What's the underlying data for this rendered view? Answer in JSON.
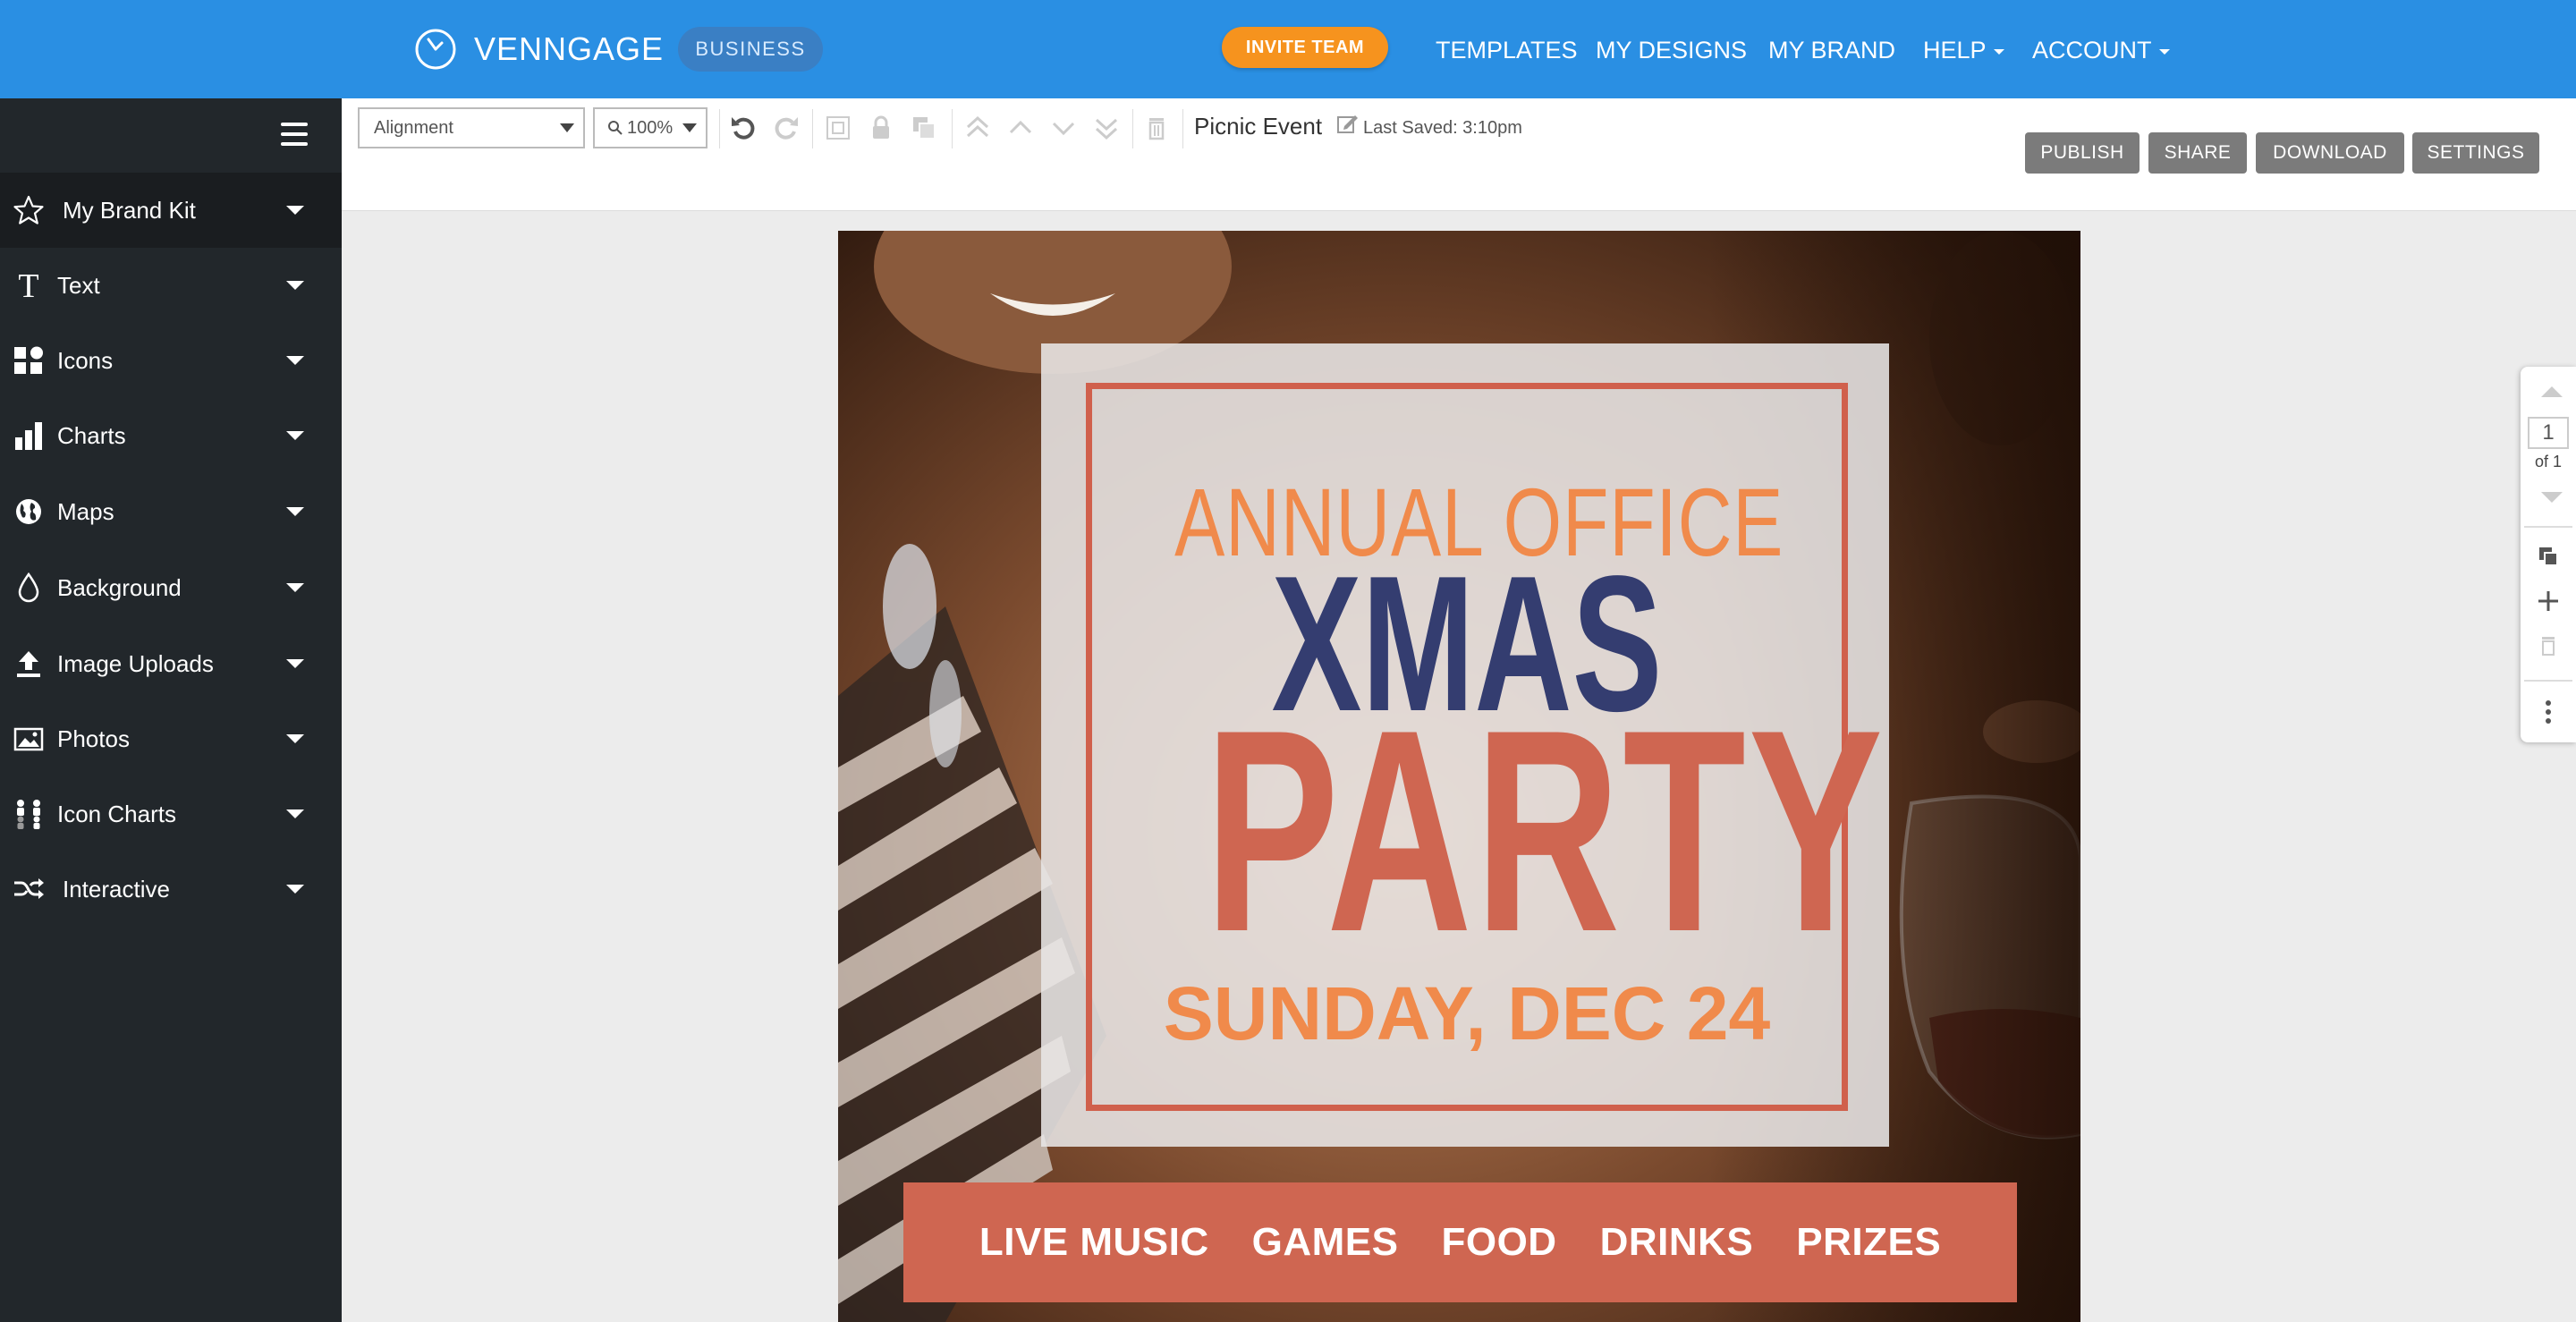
{
  "topbar": {
    "brand": "VENNGAGE",
    "plan_badge": "BUSINESS",
    "invite_label": "INVITE TEAM",
    "nav": {
      "templates": "TEMPLATES",
      "my_designs": "MY DESIGNS",
      "my_brand": "MY BRAND",
      "help": "HELP",
      "account": "ACCOUNT"
    },
    "colors": {
      "bar": "#2a8fe3",
      "invite": "#f6931e"
    }
  },
  "sidebar": {
    "items": [
      {
        "label": "My Brand Kit",
        "icon": "star-icon",
        "active": true
      },
      {
        "label": "Text",
        "icon": "text-icon"
      },
      {
        "label": "Icons",
        "icon": "shapes-icon"
      },
      {
        "label": "Charts",
        "icon": "bar-chart-icon"
      },
      {
        "label": "Maps",
        "icon": "globe-icon"
      },
      {
        "label": "Background",
        "icon": "drop-icon"
      },
      {
        "label": "Image Uploads",
        "icon": "upload-icon"
      },
      {
        "label": "Photos",
        "icon": "image-icon"
      },
      {
        "label": "Icon Charts",
        "icon": "people-chart-icon"
      },
      {
        "label": "Interactive",
        "icon": "shuffle-icon"
      }
    ]
  },
  "toolbar": {
    "alignment_value": "Alignment",
    "zoom_value": "100%",
    "doc_title": "Picnic Event",
    "last_saved": "Last Saved: 3:10pm",
    "publish": "PUBLISH",
    "share": "SHARE",
    "download": "DOWNLOAD",
    "settings": "SETTINGS"
  },
  "design": {
    "line1": "ANNUAL OFFICE",
    "line2": "XMAS",
    "line3": "PARTY",
    "line4": "SUNDAY, DEC 24",
    "features": [
      "LIVE MUSIC",
      "GAMES",
      "FOOD",
      "DRINKS",
      "PRIZES"
    ],
    "colors": {
      "orange": "#f08a4b",
      "navy": "#343d70",
      "coral": "#cf6651"
    }
  },
  "pages": {
    "current": "1",
    "of_label": "of 1"
  }
}
